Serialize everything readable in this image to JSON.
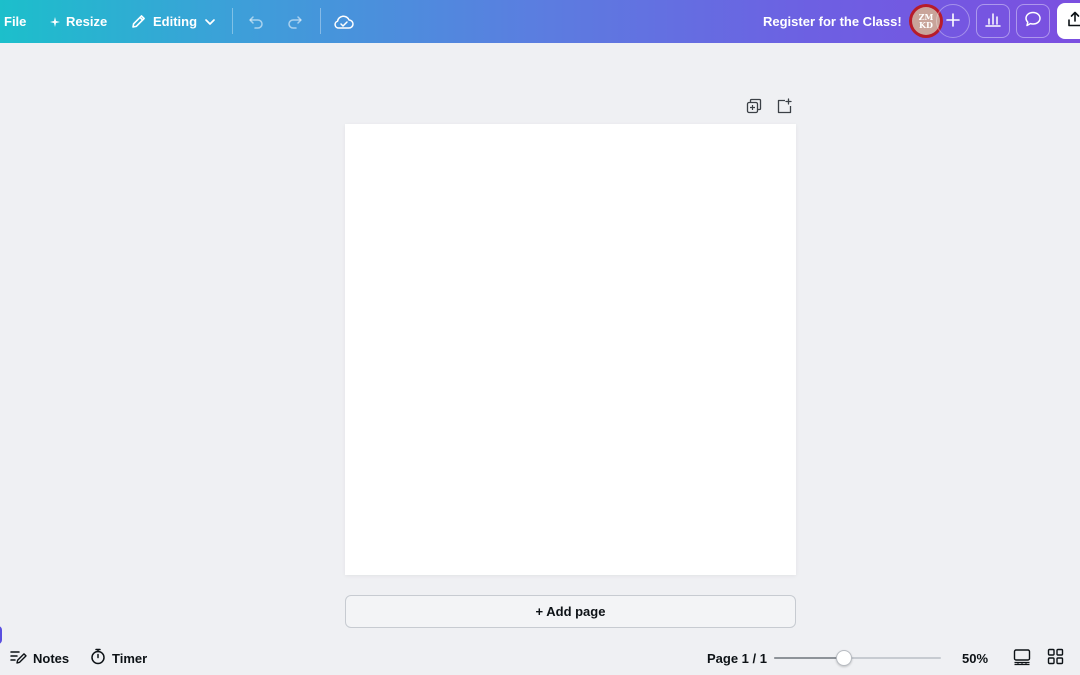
{
  "colors": {
    "gradient_start": "#1cbfcb",
    "gradient_end": "#7b4fe0",
    "background": "#eff0f3",
    "avatar_ring": "#b71c2a",
    "accent": "#5a4fe0"
  },
  "topbar": {
    "file_label": "File",
    "resize_label": "Resize",
    "resize_icon": "sparkle-icon",
    "editing_label": "Editing",
    "editing_icon": "pencil-icon",
    "undo_icon": "undo-icon",
    "redo_icon": "redo-icon",
    "save_icon": "cloud-check-icon",
    "title": "Register for the Class!",
    "avatar_initials": "ZM KD",
    "add_icon": "plus-icon",
    "insights_icon": "bar-chart-icon",
    "comments_icon": "comment-icon",
    "share_icon": "upload-icon"
  },
  "canvas": {
    "duplicate_icon": "duplicate-page-icon",
    "add_icon": "add-page-icon",
    "add_page_label": "+ Add page"
  },
  "bottombar": {
    "notes_label": "Notes",
    "notes_icon": "notes-icon",
    "timer_label": "Timer",
    "timer_icon": "stopwatch-icon",
    "page_indicator": "Page 1 / 1",
    "zoom_value": 50,
    "zoom_label": "50%",
    "zoom_fraction": 0.42,
    "pages_view_icon": "page-view-icon",
    "grid_view_icon": "grid-view-icon"
  }
}
